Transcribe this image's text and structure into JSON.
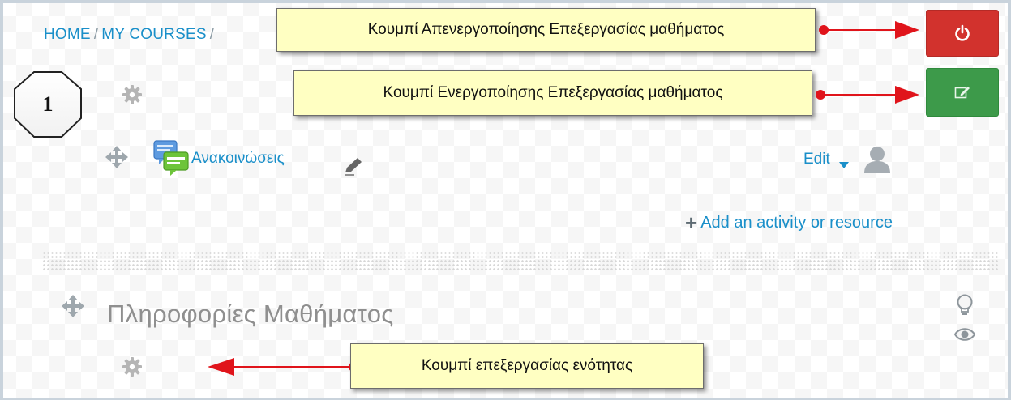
{
  "breadcrumb": {
    "home": "HOME",
    "sep1": "/",
    "my_courses": "MY COURSES",
    "sep2": "/"
  },
  "badge": {
    "number": "1"
  },
  "callouts": {
    "disable_editing": "Κουμπί Απενεργοποίησης Επεξεργασίας μαθήματος",
    "enable_editing": "Κουμπί Ενεργοποίησης Επεξεργασίας μαθήματος",
    "edit_section": "Κουμπί επεξεργασίας ενότητας"
  },
  "activity": {
    "name": "Ανακοινώσεις",
    "edit_menu": "Edit"
  },
  "add_activity": {
    "label": "Add an activity or resource"
  },
  "section": {
    "title": "Πληροφορίες Μαθήματος"
  },
  "colors": {
    "link": "#1a8fc9",
    "danger": "#d2322d",
    "success": "#3d9a4a",
    "callout": "#ffffc2",
    "arrow": "#e0141b"
  },
  "icons": {
    "gear": "gear-icon",
    "move": "move-icon",
    "forum": "forum-icon",
    "pencil": "pencil-icon",
    "power": "power-icon",
    "edit_toggle": "edit-toggle-icon",
    "user": "user-icon",
    "lightbulb": "lightbulb-icon",
    "eye": "eye-icon",
    "plus": "plus-icon"
  }
}
